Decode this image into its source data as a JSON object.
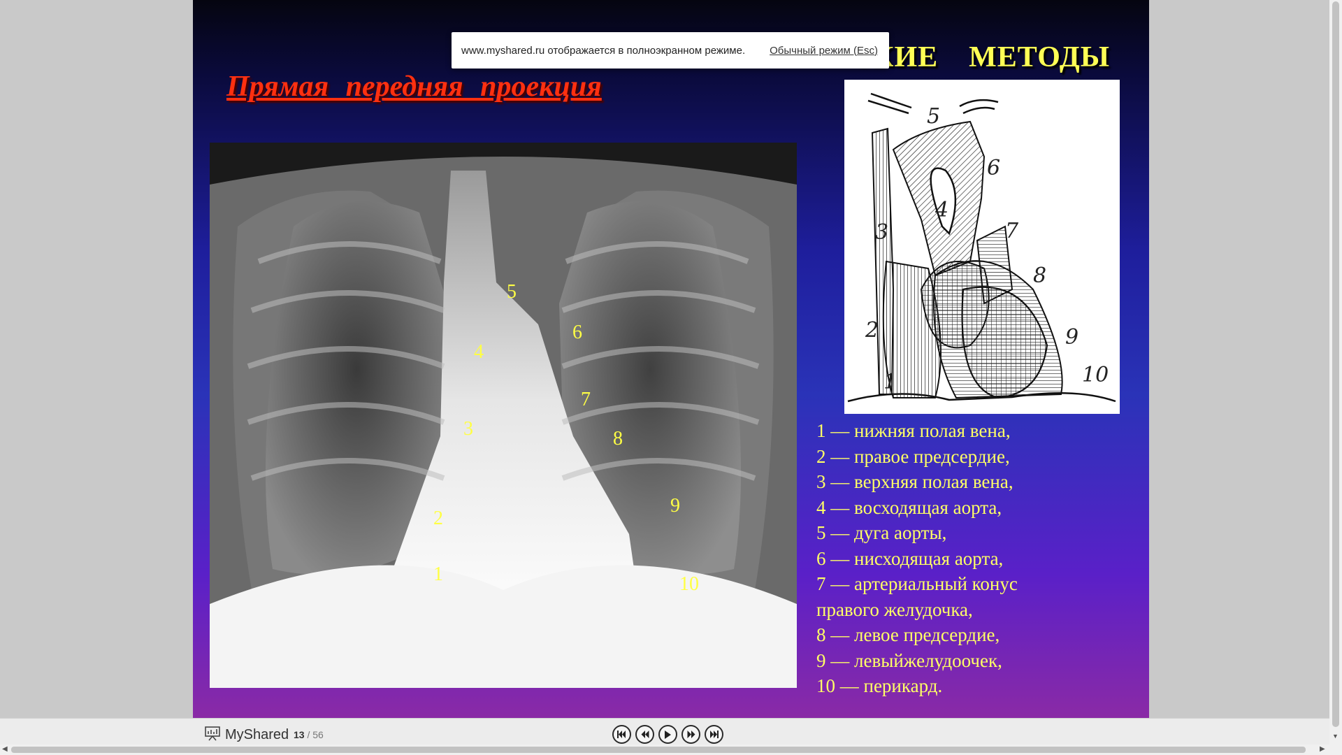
{
  "slide": {
    "heading_tail": [
      "СКИЕ",
      "МЕТОДЫ"
    ],
    "subtitle": "Прямая передняя проекция",
    "xray_labels": [
      "1",
      "2",
      "3",
      "4",
      "5",
      "6",
      "7",
      "8",
      "9",
      "10"
    ],
    "diagram_labels": [
      "1",
      "2",
      "3",
      "4",
      "5",
      "6",
      "7",
      "8",
      "9",
      "10"
    ],
    "legend": [
      "1 — нижняя полая вена,",
      "2 — правое предсердие,",
      "3 — верхняя полая вена,",
      "4 — восходящая аорта,",
      "5 — дуга аорты,",
      "6 — нисходящая аорта,",
      "7 — артериальный конус",
      "правого желудочка,",
      "8 — левое предсердие,",
      "9 — левыйжелудоочек,",
      "10 — перикард."
    ]
  },
  "fullscreen_notice": {
    "message": "www.myshared.ru отображается в полноэкранном режиме.",
    "exit_link": "Обычный режим (Esc)"
  },
  "toolbar": {
    "brand": "MyShared",
    "current_page": "13",
    "total_pages": "/ 56",
    "nav_icons": [
      "first-page-icon",
      "prev-page-icon",
      "play-icon",
      "next-page-icon",
      "last-page-icon"
    ]
  },
  "colors": {
    "heading": "#ffff55",
    "subtitle": "#ff3010",
    "labels": "#ffff44"
  }
}
